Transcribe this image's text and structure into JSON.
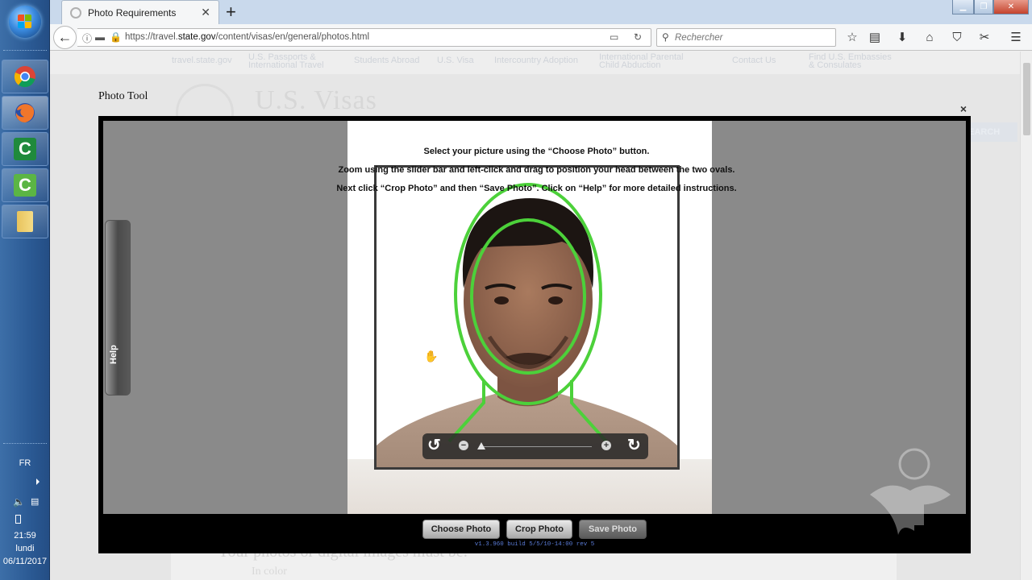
{
  "taskbar": {
    "language": "FR",
    "time": "21:59",
    "day": "lundi",
    "date": "06/11/2017",
    "apps": [
      "chrome-icon",
      "firefox-icon",
      "camtasia-icon",
      "camtasia-recorder-icon",
      "folder-icon"
    ]
  },
  "browser": {
    "tab_title": "Photo Requirements",
    "url_prefix": "https://travel.",
    "url_domain": "state.gov",
    "url_path": "/content/visas/en/general/photos.html",
    "search_placeholder": "Rechercher"
  },
  "site": {
    "nav": [
      "travel.state.gov",
      "U.S. Passports &\nInternational Travel",
      "Students Abroad",
      "U.S. Visa",
      "Intercountry Adoption",
      "International Parental\nChild Abduction",
      "Contact Us",
      "Find U.S. Embassies\n& Consulates"
    ],
    "title": "U.S. Visas",
    "search_button": "SEARCH",
    "content_heading": "Your photos or digital images must be:",
    "content_item": "In color"
  },
  "photo_tool": {
    "title": "Photo Tool",
    "close": "×",
    "instructions": [
      "Select your picture using the “Choose Photo” button.",
      "Zoom using the slider bar and left-click and drag to position your head between the two ovals.",
      "Next click “Crop Photo” and then “Save Photo”.  Click on “Help” for more detailed instructions."
    ],
    "help_label": "Help",
    "zoom_level": 0.02,
    "buttons": {
      "choose": "Choose Photo",
      "crop": "Crop Photo",
      "save": "Save Photo"
    },
    "version": "v1.3.960 build 5/5/10-14:00 rev 5",
    "oval_color": "#4cd13a"
  }
}
